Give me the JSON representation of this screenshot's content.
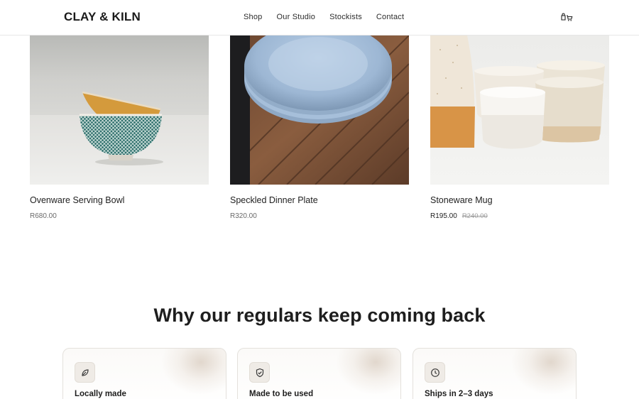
{
  "header": {
    "logo": "CLAY & KILN",
    "nav": [
      "Shop",
      "Our Studio",
      "Stockists",
      "Contact"
    ]
  },
  "products": [
    {
      "title": "Ovenware Serving Bowl",
      "price": "R680.00"
    },
    {
      "title": "Speckled Dinner Plate",
      "price": "R320.00"
    },
    {
      "title": "Stoneware Mug",
      "price": "R195.00",
      "old_price": "R240.00"
    }
  ],
  "section": {
    "title": "Why our regulars keep coming back",
    "features": [
      {
        "title": "Locally made",
        "icon": "leaf-icon"
      },
      {
        "title": "Made to be used",
        "icon": "shield-check-icon"
      },
      {
        "title": "Ships in 2–3 days",
        "icon": "clock-icon"
      }
    ]
  }
}
